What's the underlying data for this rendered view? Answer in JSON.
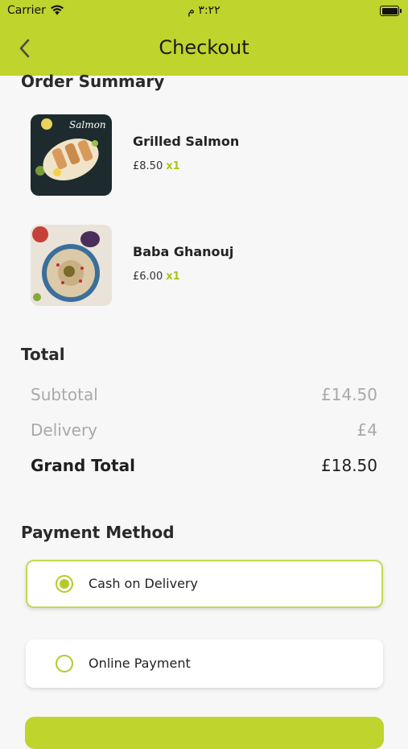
{
  "status_bar": {
    "carrier": "Carrier",
    "time": "٣:٢٢ م"
  },
  "header": {
    "title": "Checkout"
  },
  "order_summary": {
    "title": "Order Summary",
    "items": [
      {
        "name": "Grilled Salmon",
        "price": "£8.50",
        "qty": "x1",
        "image_text": "Salmon"
      },
      {
        "name": "Baba Ghanouj",
        "price": "£6.00",
        "qty": "x1"
      }
    ]
  },
  "total": {
    "title": "Total",
    "subtotal_label": "Subtotal",
    "subtotal_value": "£14.50",
    "delivery_label": "Delivery",
    "delivery_value": "£4",
    "grand_label": "Grand Total",
    "grand_value": "£18.50"
  },
  "payment": {
    "title": "Payment Method",
    "options": [
      {
        "label": "Cash on Delivery",
        "selected": true
      },
      {
        "label": "Online Payment",
        "selected": false
      }
    ]
  },
  "colors": {
    "brand": "#bfd42c",
    "accent": "#a9c61c"
  }
}
